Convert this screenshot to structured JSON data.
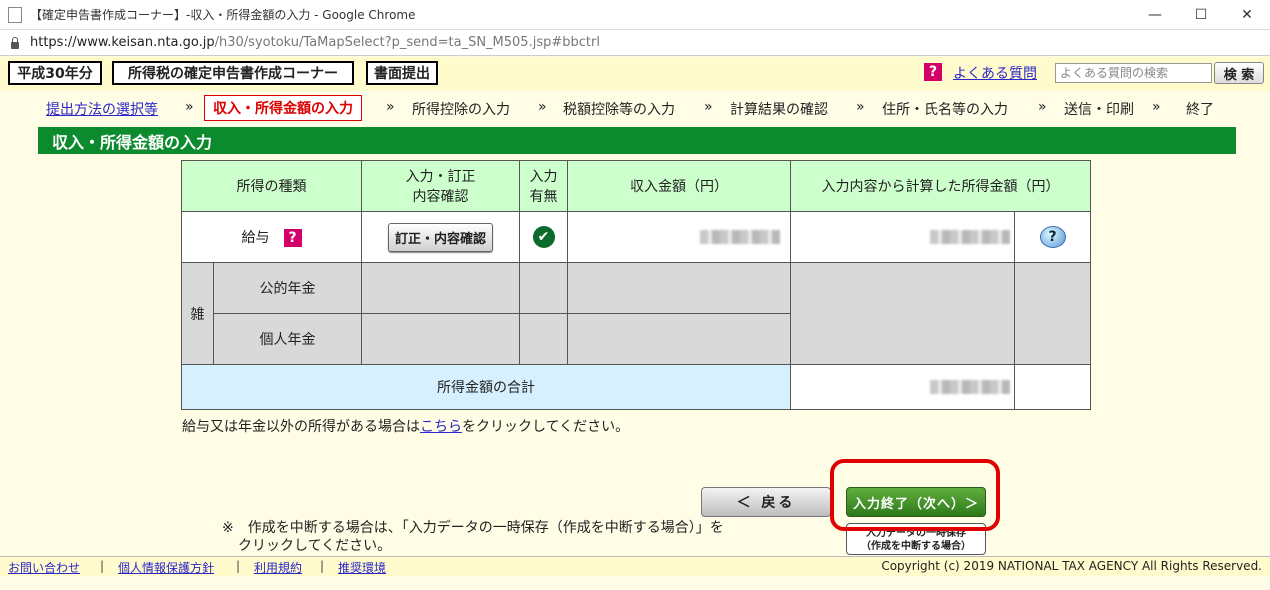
{
  "browser": {
    "title": "【確定申告書作成コーナー】-収入・所得金額の入力 - Google Chrome",
    "url_host": "https://www.keisan.nta.go.jp",
    "url_path": "/h30/syotoku/TaMapSelect?p_send=ta_SN_M505.jsp#bbctrl",
    "minimize": "—",
    "maximize": "☐",
    "close": "✕"
  },
  "header": {
    "year": "平成30年分",
    "corner": "所得税の確定申告書作成コーナー",
    "mode": "書面提出",
    "faq_icon": "?",
    "faq_link": "よくある質問",
    "faq_placeholder": "よくある質問の検索",
    "faq_button": "検 索"
  },
  "steps": {
    "s1": "提出方法の選択等",
    "s2": "収入・所得金額の入力",
    "s3": "所得控除の入力",
    "s4": "税額控除等の入力",
    "s5": "計算結果の確認",
    "s6": "住所・氏名等の入力",
    "s7": "送信・印刷",
    "s8": "終了",
    "sep": "»"
  },
  "section_title": "収入・所得金額の入力",
  "table": {
    "col_type": "所得の種類",
    "col_edit_1": "入力・訂正",
    "col_edit_2": "内容確認",
    "col_input_1": "入力",
    "col_input_2": "有無",
    "col_revenue": "収入金額（円）",
    "col_income": "入力内容から計算した所得金額（円）",
    "salary": "給与",
    "salary_help": "?",
    "correct_button": "訂正・内容確認",
    "check": "✔",
    "help_bubble": "?",
    "misc": "雑",
    "public_pension": "公的年金",
    "private_pension": "個人年金",
    "total_label": "所得金額の合計"
  },
  "note": {
    "before": "給与又は年金以外の所得がある場合は",
    "link": "こちら",
    "after": "をクリックしてください。"
  },
  "buttons": {
    "back": "＜ 戻る",
    "next": "入力終了（次へ）＞",
    "save_1": "入力データの一時保存",
    "save_2": "（作成を中断する場合）"
  },
  "interrupt": {
    "line1": "※　作成を中断する場合は、「入力データの一時保存（作成を中断する場合）」を",
    "line2": "クリックしてください。"
  },
  "footer": {
    "contact": "お問い合わせ",
    "privacy": "個人情報保護方針",
    "terms": "利用規約",
    "env": "推奨環境",
    "sep": "|",
    "copyright": "Copyright (c) 2019 NATIONAL TAX AGENCY All Rights Reserved."
  },
  "colors": {
    "accent_green": "#0c8b2e",
    "highlight_red": "#e00000",
    "link_blue": "#2b27c9",
    "help_magenta": "#d4006a"
  }
}
